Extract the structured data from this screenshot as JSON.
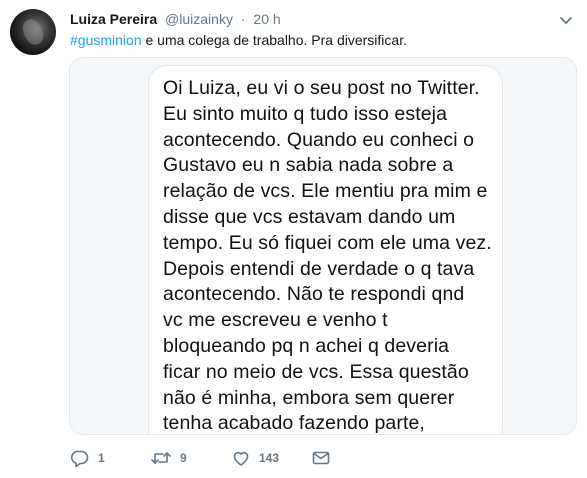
{
  "tweet": {
    "author_name": "Luiza Pereira",
    "author_handle": "@luizainky",
    "separator": "·",
    "time": "20 h",
    "hashtag": "#gusminion",
    "text_rest": " e uma colega de trabalho. Pra diversificar."
  },
  "image_text": [
    "Oi Luiza, eu vi o seu post no Twitter.",
    "Eu sinto muito q tudo isso esteja",
    "acontecendo. Quando eu conheci o",
    "Gustavo eu n sabia nada sobre a",
    "relação de vcs. Ele mentiu pra mim e",
    "disse que vcs estavam dando um",
    "tempo. Eu só fiquei com ele uma vez.",
    "Depois entendi de verdade o q tava",
    "acontecendo. Não te respondi qnd",
    "vc me escreveu e venho t",
    "bloqueando pq n achei q deveria",
    "ficar no meio de vcs. Essa questão",
    "não é minha, embora sem querer",
    "tenha acabado fazendo parte,"
  ],
  "actions": {
    "reply_count": "1",
    "retweet_count": "9",
    "like_count": "143"
  },
  "icons": {
    "reply": "reply-icon",
    "retweet": "retweet-icon",
    "like": "heart-icon",
    "message": "envelope-icon",
    "menu": "chevron-down-icon"
  },
  "colors": {
    "link": "#1da1f2",
    "muted": "#657786",
    "text": "#14171a"
  }
}
